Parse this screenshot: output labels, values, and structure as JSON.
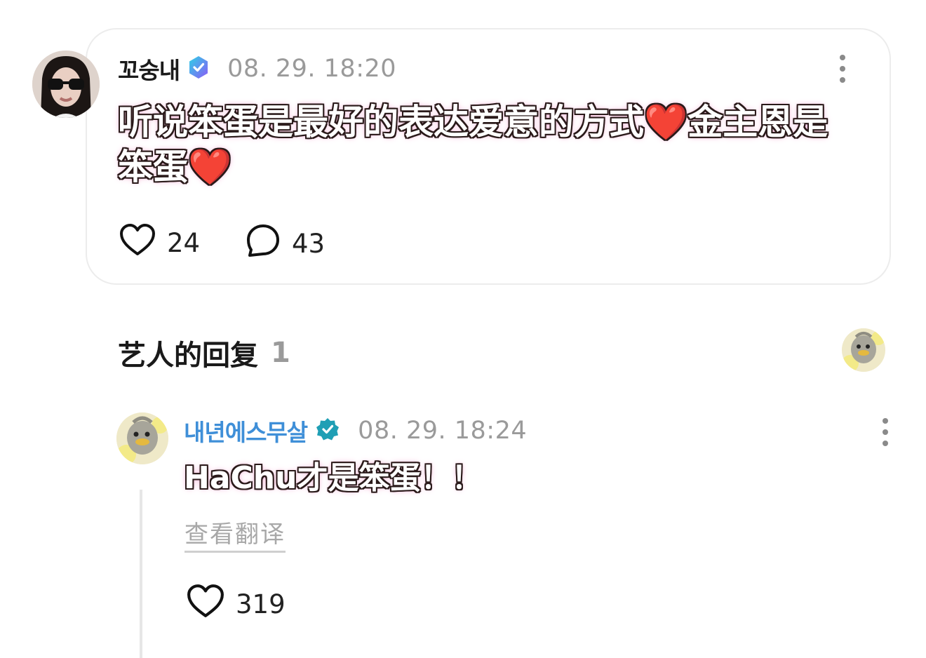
{
  "post": {
    "author": "꼬숭내",
    "verified_icon": "verified-badge-icon",
    "timestamp": "08. 29. 18:20",
    "text": "听说笨蛋是最好的表达爱意的方式❤️金主恩是笨蛋❤️",
    "likes": "24",
    "comments": "43",
    "colors": {
      "verified_badge": "#7b6cf6"
    }
  },
  "replies_section": {
    "title": "艺人的回复",
    "count": "1"
  },
  "reply": {
    "author": "내년에스무살",
    "verified_icon": "verified-badge-icon",
    "timestamp": "08. 29. 18:24",
    "text": "HaChu才是笨蛋！！",
    "translate_label": "查看翻译",
    "likes": "319",
    "colors": {
      "author_name": "#3f8fd8",
      "verified_badge": "#1f9fb5"
    }
  }
}
